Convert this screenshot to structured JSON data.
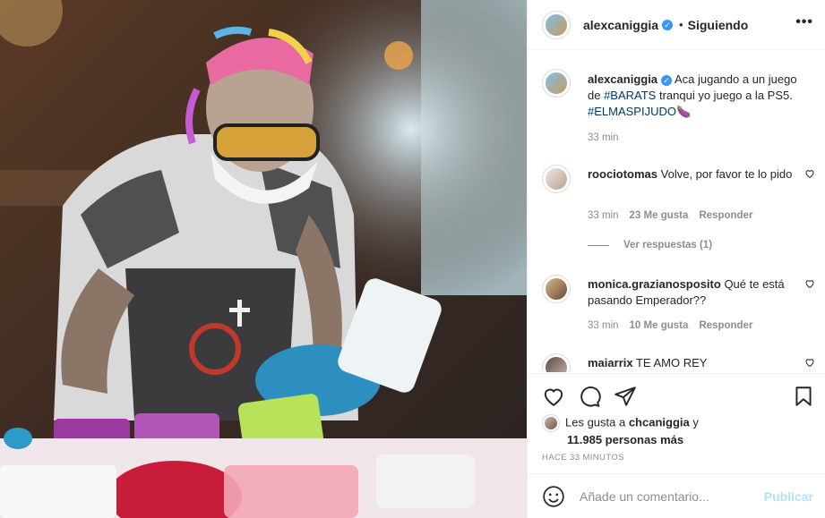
{
  "post": {
    "username": "alexcaniggia",
    "follow_status": "Siguiendo",
    "more": "•••",
    "caption_parts": {
      "text1": "Aca jugando a un juego de ",
      "tag1": "#BARATS",
      "text2": " tranqui yo juego a la PS5. ",
      "tag2": "#ELMASPIJUDO",
      "emoji": "🍆"
    },
    "caption_time": "33 min"
  },
  "comments": [
    {
      "username": "roociotomas",
      "text": "Volve, por favor te lo pido",
      "time": "33 min",
      "likes": "23 Me gusta",
      "reply": "Responder"
    },
    {
      "username": "monica.grazianosposito",
      "text": "Qué te está pasando Emperador??",
      "time": "33 min",
      "likes": "10 Me gusta",
      "reply": "Responder"
    },
    {
      "username": "maiarrix",
      "text": "TE AMO REY"
    }
  ],
  "view_replies": "Ver respuestas (1)",
  "likes": {
    "prefix": "Les gusta a ",
    "liker": "chcaniggia",
    "conj": " y",
    "rest": "11.985 personas más"
  },
  "timestamp": "HACE 33 MINUTOS",
  "add_comment": {
    "placeholder": "Añade un comentario...",
    "post_label": "Publicar"
  },
  "icons": {
    "like": "heart-icon",
    "comment": "comment-icon",
    "share": "paper-plane-icon",
    "save": "bookmark-icon",
    "emoji": "smiley-icon",
    "verified": "verified-badge-icon"
  },
  "colors": {
    "accent": "#3897f0",
    "hashtag": "#00376b",
    "muted": "#8e8e8e",
    "publish_disabled": "#b2dffc"
  }
}
